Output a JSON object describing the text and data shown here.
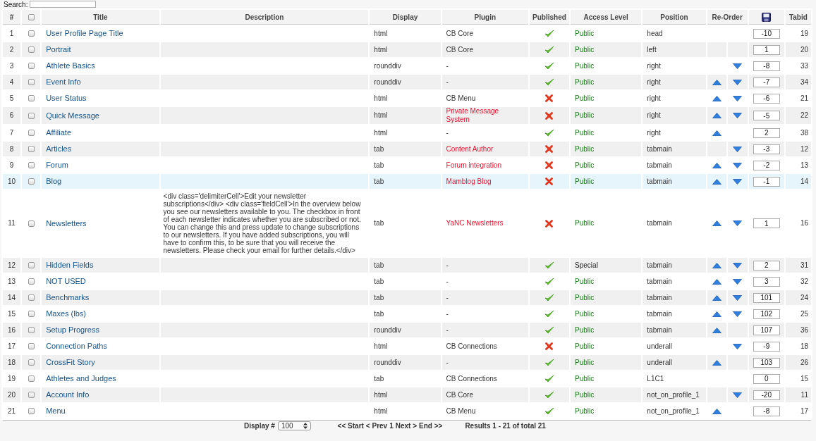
{
  "search": {
    "label": "Search:"
  },
  "columns": [
    "#",
    "Title",
    "Description",
    "Display",
    "Plugin",
    "Published",
    "Access Level",
    "Position",
    "Re-Order",
    "Tabid"
  ],
  "select_all": {
    "checked": false
  },
  "rows": [
    {
      "n": "1",
      "checked": false,
      "selected": false,
      "title": "User Profile Page Title",
      "display": "html",
      "plugin": "CB Core",
      "plugin_missing": false,
      "published": true,
      "access": "Public",
      "special_access": false,
      "position": "head",
      "up": false,
      "down": false,
      "order": "-10",
      "tabid": "19"
    },
    {
      "n": "2",
      "checked": false,
      "selected": false,
      "title": "Portrait",
      "display": "html",
      "plugin": "CB Core",
      "plugin_missing": false,
      "published": true,
      "access": "Public",
      "special_access": false,
      "position": "left",
      "up": false,
      "down": false,
      "order": "1",
      "tabid": "20"
    },
    {
      "n": "3",
      "checked": false,
      "selected": false,
      "title": "Athlete Basics",
      "display": "rounddiv",
      "plugin": "-",
      "plugin_missing": false,
      "published": true,
      "access": "Public",
      "special_access": false,
      "position": "right",
      "up": false,
      "down": true,
      "order": "-8",
      "tabid": "33"
    },
    {
      "n": "4",
      "checked": false,
      "selected": false,
      "title": "Event Info",
      "display": "rounddiv",
      "plugin": "-",
      "plugin_missing": false,
      "published": true,
      "access": "Public",
      "special_access": false,
      "position": "right",
      "up": true,
      "down": true,
      "order": "-7",
      "tabid": "34"
    },
    {
      "n": "5",
      "checked": false,
      "selected": false,
      "title": "User Status",
      "display": "html",
      "plugin": "CB Menu",
      "plugin_missing": false,
      "published": false,
      "access": "Public",
      "special_access": false,
      "position": "right",
      "up": true,
      "down": true,
      "order": "-6",
      "tabid": "21"
    },
    {
      "n": "6",
      "checked": false,
      "selected": false,
      "title": "Quick Message",
      "display": "html",
      "plugin": "Private Message System",
      "plugin_missing": true,
      "published": false,
      "access": "Public",
      "special_access": false,
      "position": "right",
      "up": true,
      "down": true,
      "order": "-5",
      "tabid": "22"
    },
    {
      "n": "7",
      "checked": false,
      "selected": false,
      "title": "Affiliate",
      "display": "html",
      "plugin": "-",
      "plugin_missing": false,
      "published": true,
      "access": "Public",
      "special_access": false,
      "position": "right",
      "up": true,
      "down": false,
      "order": "2",
      "tabid": "38"
    },
    {
      "n": "8",
      "checked": false,
      "selected": false,
      "title": "Articles",
      "display": "tab",
      "plugin": "Content Author",
      "plugin_missing": true,
      "published": false,
      "access": "Public",
      "special_access": false,
      "position": "tabmain",
      "up": false,
      "down": true,
      "order": "-3",
      "tabid": "12"
    },
    {
      "n": "9",
      "checked": false,
      "selected": false,
      "title": "Forum",
      "display": "tab",
      "plugin": "Forum integration",
      "plugin_missing": true,
      "published": false,
      "access": "Public",
      "special_access": false,
      "position": "tabmain",
      "up": true,
      "down": true,
      "order": "-2",
      "tabid": "13"
    },
    {
      "n": "10",
      "checked": false,
      "selected": true,
      "title": "Blog",
      "display": "tab",
      "plugin": "Mamblog Blog",
      "plugin_missing": true,
      "published": false,
      "access": "Public",
      "special_access": false,
      "position": "tabmain",
      "up": true,
      "down": true,
      "order": "-1",
      "tabid": "14"
    },
    {
      "n": "11",
      "checked": false,
      "selected": false,
      "title": "Newsletters",
      "description": "<div class='delimiterCell'>Edit your newsletter subscriptions</div> <div class='fieldCell'>In the overview below you see our newsletters available to you. The checkbox in front of each newsletter indicates whether you are subscribed or not. You can change this and press update to change subscriptions to our newsletters. If you have added subscriptions, you will have to confirm this, to be sure that you will receive the newsletters. Please check your email for further details.</div>",
      "display": "tab",
      "plugin": "YaNC Newsletters",
      "plugin_missing": true,
      "published": false,
      "access": "Public",
      "special_access": false,
      "position": "tabmain",
      "up": true,
      "down": true,
      "order": "1",
      "tabid": "16"
    },
    {
      "n": "12",
      "checked": false,
      "selected": false,
      "title": "Hidden Fields",
      "display": "tab",
      "plugin": "-",
      "plugin_missing": false,
      "published": true,
      "access": "Special",
      "special_access": true,
      "position": "tabmain",
      "up": true,
      "down": true,
      "order": "2",
      "tabid": "31"
    },
    {
      "n": "13",
      "checked": false,
      "selected": false,
      "title": "NOT USED",
      "display": "tab",
      "plugin": "-",
      "plugin_missing": false,
      "published": true,
      "access": "Public",
      "special_access": false,
      "position": "tabmain",
      "up": true,
      "down": true,
      "order": "3",
      "tabid": "32"
    },
    {
      "n": "14",
      "checked": false,
      "selected": false,
      "title": "Benchmarks",
      "display": "tab",
      "plugin": "-",
      "plugin_missing": false,
      "published": true,
      "access": "Public",
      "special_access": false,
      "position": "tabmain",
      "up": true,
      "down": true,
      "order": "101",
      "tabid": "24"
    },
    {
      "n": "15",
      "checked": false,
      "selected": false,
      "title": "Maxes (lbs)",
      "display": "tab",
      "plugin": "-",
      "plugin_missing": false,
      "published": true,
      "access": "Public",
      "special_access": false,
      "position": "tabmain",
      "up": true,
      "down": true,
      "order": "102",
      "tabid": "25"
    },
    {
      "n": "16",
      "checked": false,
      "selected": false,
      "title": "Setup Progress",
      "display": "rounddiv",
      "plugin": "-",
      "plugin_missing": false,
      "published": true,
      "access": "Public",
      "special_access": false,
      "position": "tabmain",
      "up": true,
      "down": false,
      "order": "107",
      "tabid": "36"
    },
    {
      "n": "17",
      "checked": false,
      "selected": false,
      "title": "Connection Paths",
      "display": "html",
      "plugin": "CB Connections",
      "plugin_missing": false,
      "published": false,
      "access": "Public",
      "special_access": false,
      "position": "underall",
      "up": false,
      "down": true,
      "order": "-9",
      "tabid": "18"
    },
    {
      "n": "18",
      "checked": false,
      "selected": false,
      "title": "CrossFit Story",
      "display": "rounddiv",
      "plugin": "-",
      "plugin_missing": false,
      "published": true,
      "access": "Public",
      "special_access": false,
      "position": "underall",
      "up": true,
      "down": false,
      "order": "103",
      "tabid": "26"
    },
    {
      "n": "19",
      "checked": false,
      "selected": false,
      "title": "Athletes and Judges",
      "display": "tab",
      "plugin": "CB Connections",
      "plugin_missing": false,
      "published": true,
      "access": "Public",
      "special_access": false,
      "position": "L1C1",
      "up": false,
      "down": false,
      "order": "0",
      "tabid": "15"
    },
    {
      "n": "20",
      "checked": false,
      "selected": false,
      "title": "Account Info",
      "display": "html",
      "plugin": "CB Core",
      "plugin_missing": false,
      "published": true,
      "access": "Public",
      "special_access": false,
      "position": "not_on_profile_1",
      "up": false,
      "down": true,
      "order": "-20",
      "tabid": "11"
    },
    {
      "n": "21",
      "checked": false,
      "selected": false,
      "title": "Menu",
      "display": "html",
      "plugin": "CB Menu",
      "plugin_missing": false,
      "published": true,
      "access": "Public",
      "special_access": false,
      "position": "not_on_profile_1",
      "up": true,
      "down": false,
      "order": "-8",
      "tabid": "17"
    }
  ],
  "footer": {
    "display_label": "Display #",
    "display_value": "100",
    "pages": [
      "<< Start",
      "< Prev",
      "1",
      "Next >",
      "End >>"
    ],
    "results": "Results 1 - 21 of total 21"
  }
}
